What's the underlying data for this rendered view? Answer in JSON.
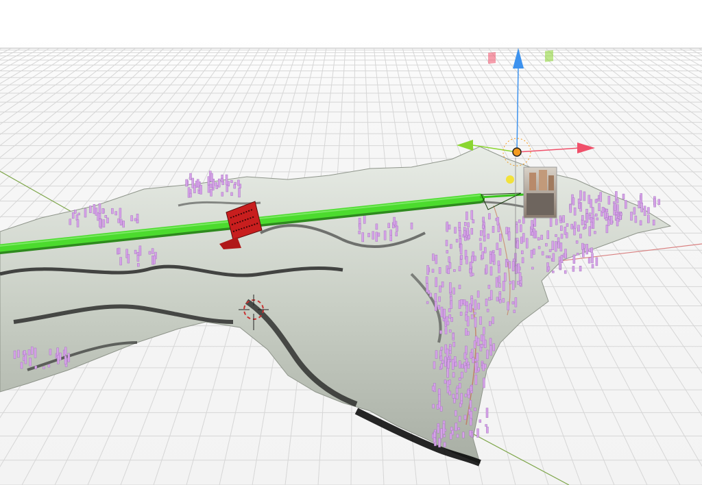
{
  "viewport": {
    "mode": "3d-perspective",
    "background": "#f4f4f4",
    "grid_color": "#d6d6d6",
    "axis_x_color": "#d98080",
    "axis_y_color": "#7ea64a"
  },
  "scene_objects": [
    {
      "name": "terrain-mesh",
      "color": "#c9cfc5"
    },
    {
      "name": "building-points",
      "color": "#d6a2e8"
    },
    {
      "name": "route-path",
      "color": "#4cdb2e"
    },
    {
      "name": "red-marker",
      "color": "#c81e1e"
    },
    {
      "name": "camera-photo-plane"
    },
    {
      "name": "sun-light",
      "color": "#f2e23a"
    },
    {
      "name": "3d-cursor"
    }
  ],
  "gizmo": {
    "x_color": "#f0506a",
    "y_color": "#8ad630",
    "z_color": "#3d92ee",
    "origin_color": "#f39a1f"
  }
}
